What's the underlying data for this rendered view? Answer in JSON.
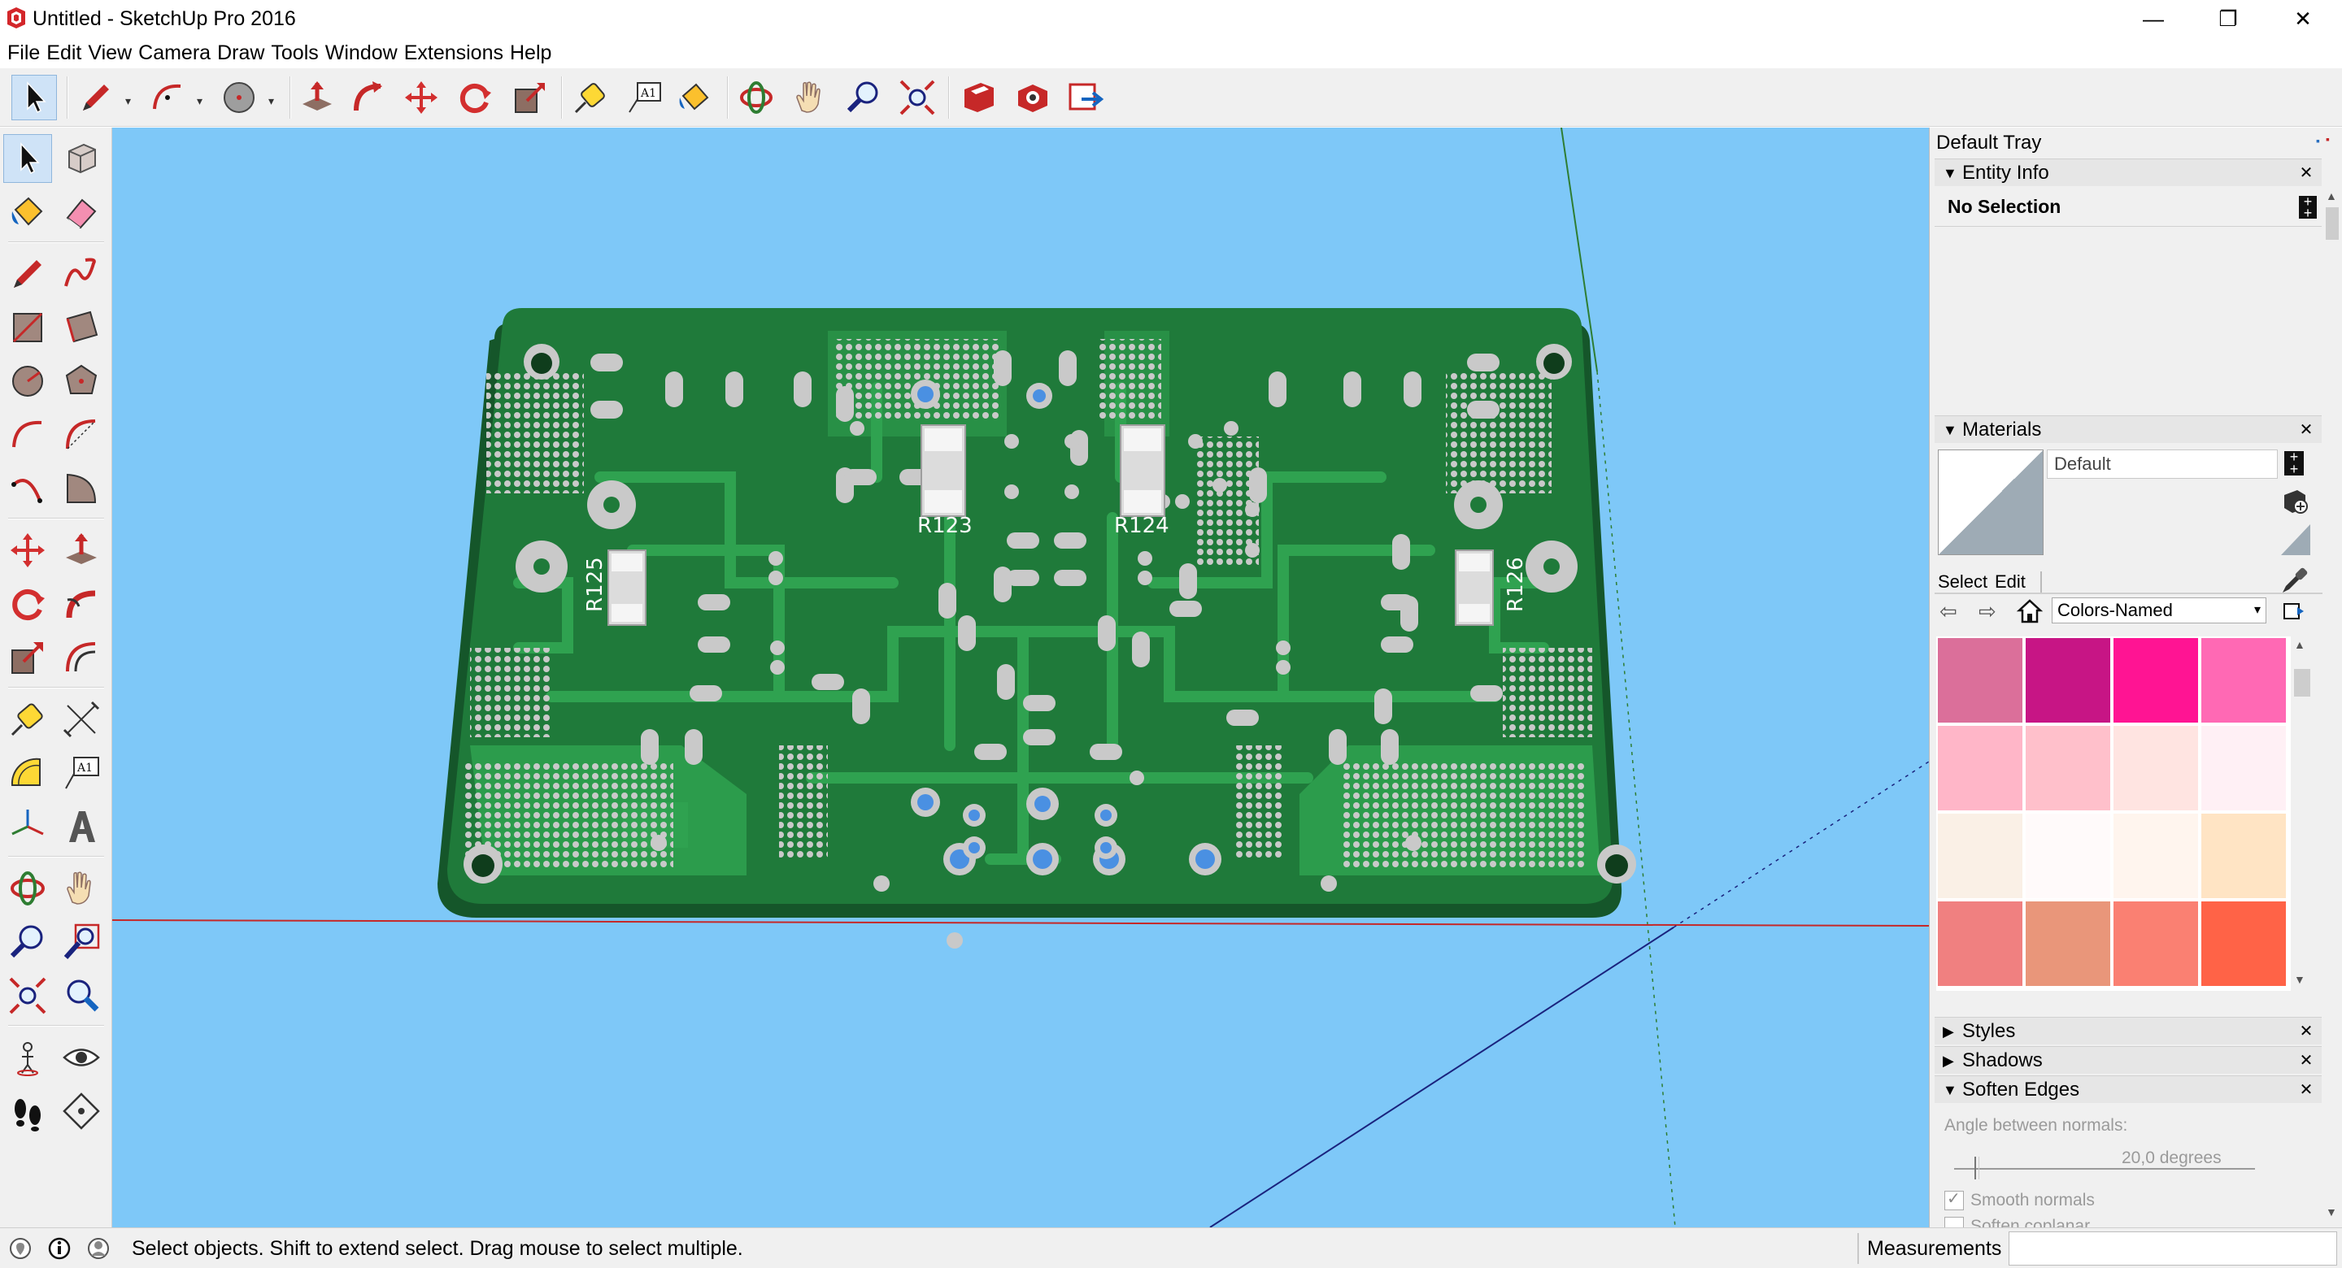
{
  "window": {
    "title": "Untitled - SketchUp Pro 2016",
    "minimize_glyph": "—",
    "maximize_glyph": "❐",
    "close_glyph": "✕"
  },
  "menu": [
    "File",
    "Edit",
    "View",
    "Camera",
    "Draw",
    "Tools",
    "Window",
    "Extensions",
    "Help"
  ],
  "toolbar": {
    "tools": [
      "select",
      "pencil",
      "arc",
      "circle",
      "push-pull",
      "follow-me",
      "move",
      "rotate",
      "scale",
      "tape-measure",
      "text",
      "paint-bucket",
      "orbit",
      "pan",
      "zoom",
      "zoom-extents",
      "3d-warehouse",
      "extension-warehouse",
      "send-to-layout"
    ]
  },
  "viewport": {
    "background_color": "#7ec8f8",
    "pcb": {
      "board_color": "#1f7a3a",
      "copper_color": "#2fa250",
      "pad_color": "#c9c9c9",
      "labels": {
        "r123": "R123",
        "r124": "R124",
        "r125": "R125",
        "r126": "R126"
      }
    },
    "text_tool_label": "A1"
  },
  "tray": {
    "title": "Default Tray",
    "entity_info": {
      "header": "Entity Info",
      "value": "No Selection"
    },
    "materials": {
      "header": "Materials",
      "material_name": "Default",
      "tab_select": "Select",
      "tab_edit": "Edit",
      "library": "Colors-Named",
      "swatches": [
        "#db6f9a",
        "#c71585",
        "#ff1493",
        "#ff69b4",
        "#ffb6c8",
        "#ffc0cb",
        "#ffe4e1",
        "#fff0f5",
        "#faf0e6",
        "#fffafa",
        "#fff5ee",
        "#ffe4c4",
        "#f08080",
        "#e9967a",
        "#fa8072",
        "#ff6347"
      ]
    },
    "styles_header": "Styles",
    "shadows_header": "Shadows",
    "soften_edges": {
      "header": "Soften Edges",
      "angle_label": "Angle between normals:",
      "angle_value": "20,0  degrees",
      "angle_fraction": 0.07,
      "smooth_normals": "Smooth normals",
      "soften_coplanar": "Soften coplanar",
      "smooth_checked": true,
      "coplanar_checked": false
    },
    "collapsed_glyph": "▶",
    "expanded_glyph": "▼",
    "close_glyph": "✕"
  },
  "status": {
    "message": "Select objects. Shift to extend select. Drag mouse to select multiple.",
    "measurements_label": "Measurements",
    "measurements_value": ""
  }
}
